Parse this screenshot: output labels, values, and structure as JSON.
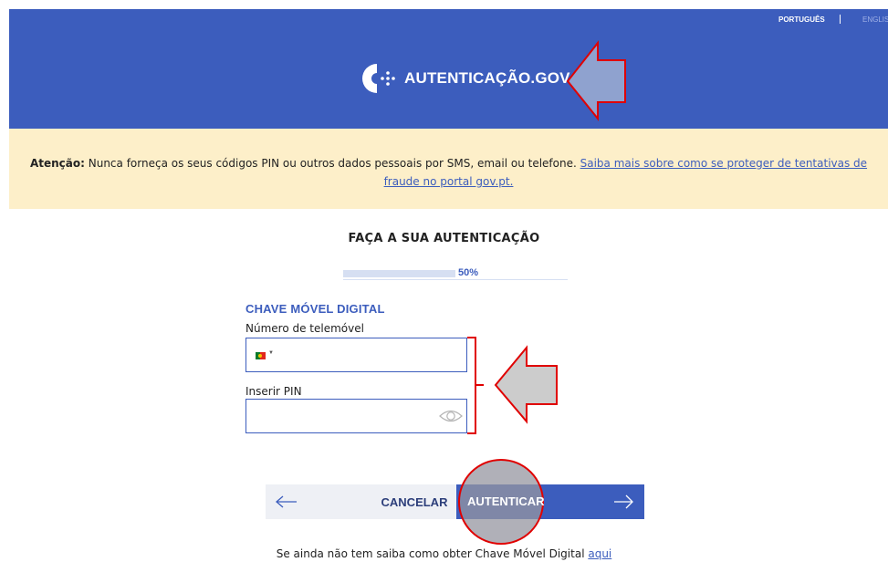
{
  "languages": {
    "active": "PORTUGUÊS",
    "inactive": "ENGLISH"
  },
  "header": {
    "title": "AUTENTICAÇÃO.GOV"
  },
  "alert": {
    "bold": "Atenção:",
    "text": " Nunca forneça os seus códigos PIN ou outros dados pessoais por SMS, email ou telefone. ",
    "link": "Saiba mais sobre como se proteger de tentativas de fraude no portal gov.pt."
  },
  "page": {
    "title": "FAÇA A SUA AUTENTICAÇÃO"
  },
  "progress": {
    "label": "50%",
    "value": 0.5
  },
  "form": {
    "section_title": "CHAVE MÓVEL DIGITAL",
    "phone_label": "Número de telemóvel",
    "phone_value": "",
    "pin_label": "Inserir PIN",
    "pin_value": "",
    "country_flag": "portugal-flag"
  },
  "actions": {
    "cancel": "CANCELAR",
    "submit": "AUTENTICAR"
  },
  "footer": {
    "text": "Se ainda não tem saiba como obter Chave Móvel Digital ",
    "link": "aqui"
  },
  "colors": {
    "brand": "#3c5dbd",
    "alert_bg": "#fdefc9",
    "annotation": "#e00000"
  }
}
